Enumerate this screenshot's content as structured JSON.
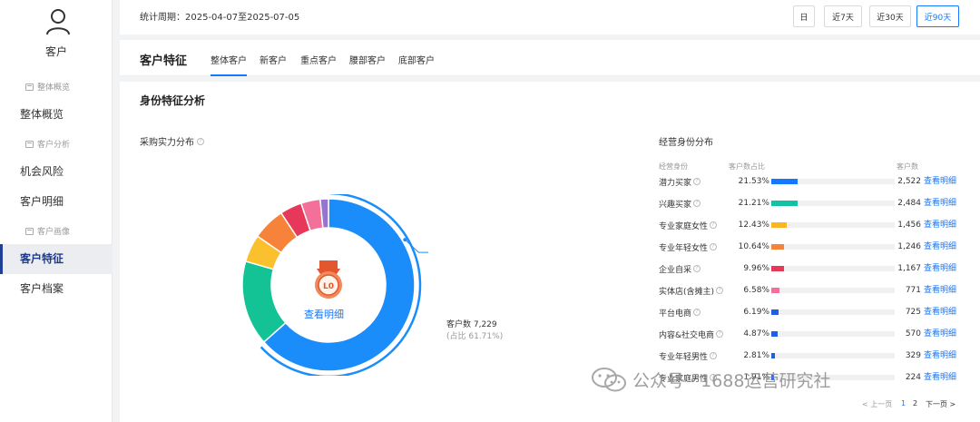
{
  "sidebar": {
    "title": "客户",
    "groups": [
      "整体概览",
      "客户分析",
      "客户画像"
    ],
    "items": [
      {
        "label": "整体概览"
      },
      {
        "label": "机会风险"
      },
      {
        "label": "客户明细"
      },
      {
        "label": "客户特征"
      },
      {
        "label": "客户档案"
      }
    ],
    "active": "客户特征"
  },
  "topbar": {
    "period_label": "统计周期：",
    "period_value": "2025-04-07至2025-07-05",
    "ranges": [
      "日",
      "近7天",
      "近30天",
      "近90天"
    ],
    "active_range": "近90天"
  },
  "tabbar": {
    "title": "客户特征",
    "tabs": [
      "整体客户",
      "新客户",
      "重点客户",
      "腰部客户",
      "底部客户"
    ],
    "active": "整体客户"
  },
  "section": {
    "title": "身份特征分析",
    "left_title": "采购实力分布",
    "right_title": "经营身份分布"
  },
  "donut": {
    "center_badge": "L0",
    "center_link": "查看明细",
    "callout_count": "客户数 7,229",
    "callout_pct": "(占比 61.71%)"
  },
  "table": {
    "headers": [
      "经营身份",
      "客户数占比",
      "客户数"
    ],
    "rows": [
      {
        "name": "潜力买家",
        "pct": "21.53%",
        "value": 21.53,
        "count": "2,522",
        "color": "#1677ff",
        "link": "查看明细"
      },
      {
        "name": "兴趣买家",
        "pct": "21.21%",
        "value": 21.21,
        "count": "2,484",
        "color": "#13c2a3",
        "link": "查看明细"
      },
      {
        "name": "专业家庭女性",
        "pct": "12.43%",
        "value": 12.43,
        "count": "1,456",
        "color": "#fab521",
        "link": "查看明细"
      },
      {
        "name": "专业年轻女性",
        "pct": "10.64%",
        "value": 10.64,
        "count": "1,246",
        "color": "#f7833b",
        "link": "查看明细"
      },
      {
        "name": "企业自采",
        "pct": "9.96%",
        "value": 9.96,
        "count": "1,167",
        "color": "#e8385a",
        "link": "查看明细"
      },
      {
        "name": "实体店(含摊主)",
        "pct": "6.58%",
        "value": 6.58,
        "count": "771",
        "color": "#f3709a",
        "link": "查看明细"
      },
      {
        "name": "平台电商",
        "pct": "6.19%",
        "value": 6.19,
        "count": "725",
        "color": "#1f5fe6",
        "link": "查看明细"
      },
      {
        "name": "内容&社交电商",
        "pct": "4.87%",
        "value": 4.87,
        "count": "570",
        "color": "#1f5fe6",
        "link": "查看明细"
      },
      {
        "name": "专业年轻男性",
        "pct": "2.81%",
        "value": 2.81,
        "count": "329",
        "color": "#1f5fe6",
        "link": "查看明细"
      },
      {
        "name": "专业家庭男性",
        "pct": "1.91%",
        "value": 1.91,
        "count": "224",
        "color": "#1f5fe6",
        "link": "查看明细"
      }
    ]
  },
  "pager": {
    "prev": "< 上一页",
    "pages": [
      "1",
      "2"
    ],
    "active": "1",
    "next": "下一页 >"
  },
  "chart_data": {
    "type": "pie",
    "categories": [
      "L0",
      "",
      "",
      "",
      "",
      "",
      ""
    ],
    "values": [
      61.71,
      15.5,
      5.0,
      6.0,
      4.0,
      3.5,
      1.5
    ],
    "colors": [
      "#1b8dfb",
      "#13c295",
      "#fbc02d",
      "#f7833b",
      "#e8385a",
      "#f3709a",
      "#9575cd"
    ]
  },
  "watermark": "公众号 · 1688运营研究社"
}
